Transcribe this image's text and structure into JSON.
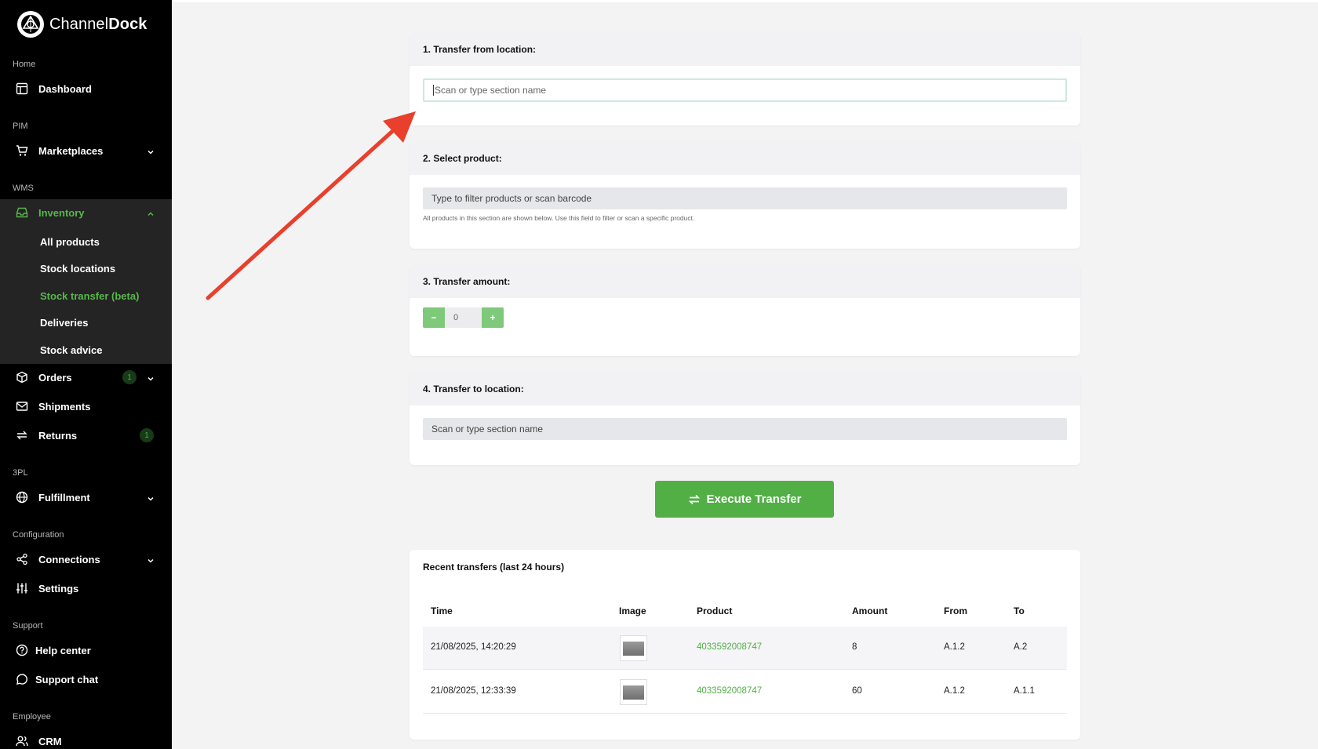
{
  "brand": {
    "name_light": "Channel",
    "name_bold": "Dock"
  },
  "sidebar": {
    "sections": {
      "home": "Home",
      "pim": "PIM",
      "wms": "WMS",
      "threepl": "3PL",
      "configuration": "Configuration",
      "support": "Support",
      "employee": "Employee"
    },
    "items": {
      "dashboard": "Dashboard",
      "marketplaces": "Marketplaces",
      "inventory": "Inventory",
      "orders": "Orders",
      "orders_badge": "1",
      "shipments": "Shipments",
      "returns": "Returns",
      "returns_badge": "1",
      "fulfillment": "Fulfillment",
      "connections": "Connections",
      "settings": "Settings",
      "help_center": "Help center",
      "support_chat": "Support chat",
      "crm": "CRM"
    },
    "inventory_sub": {
      "all_products": "All products",
      "stock_locations": "Stock locations",
      "stock_transfer": "Stock transfer (beta)",
      "deliveries": "Deliveries",
      "stock_advice": "Stock advice"
    },
    "accent_color": "#56b84a"
  },
  "form": {
    "step1": {
      "title": "1. Transfer from location:",
      "placeholder": "Scan or type section name"
    },
    "step2": {
      "title": "2. Select product:",
      "placeholder": "Type to filter products or scan barcode",
      "help": "All products in this section are shown below. Use this field to filter or scan a specific product."
    },
    "step3": {
      "title": "3. Transfer amount:",
      "minus": "−",
      "value": "0",
      "plus": "+"
    },
    "step4": {
      "title": "4. Transfer to location:",
      "placeholder": "Scan or type section name"
    },
    "execute_label": "Execute Transfer"
  },
  "recent": {
    "title": "Recent transfers (last 24 hours)",
    "columns": {
      "time": "Time",
      "image": "Image",
      "product": "Product",
      "amount": "Amount",
      "from": "From",
      "to": "To"
    },
    "rows": [
      {
        "time": "21/08/2025, 14:20:29",
        "product": "4033592008747",
        "amount": "8",
        "from": "A.1.2",
        "to": "A.2"
      },
      {
        "time": "21/08/2025, 12:33:39",
        "product": "4033592008747",
        "amount": "60",
        "from": "A.1.2",
        "to": "A.1.1"
      }
    ]
  }
}
